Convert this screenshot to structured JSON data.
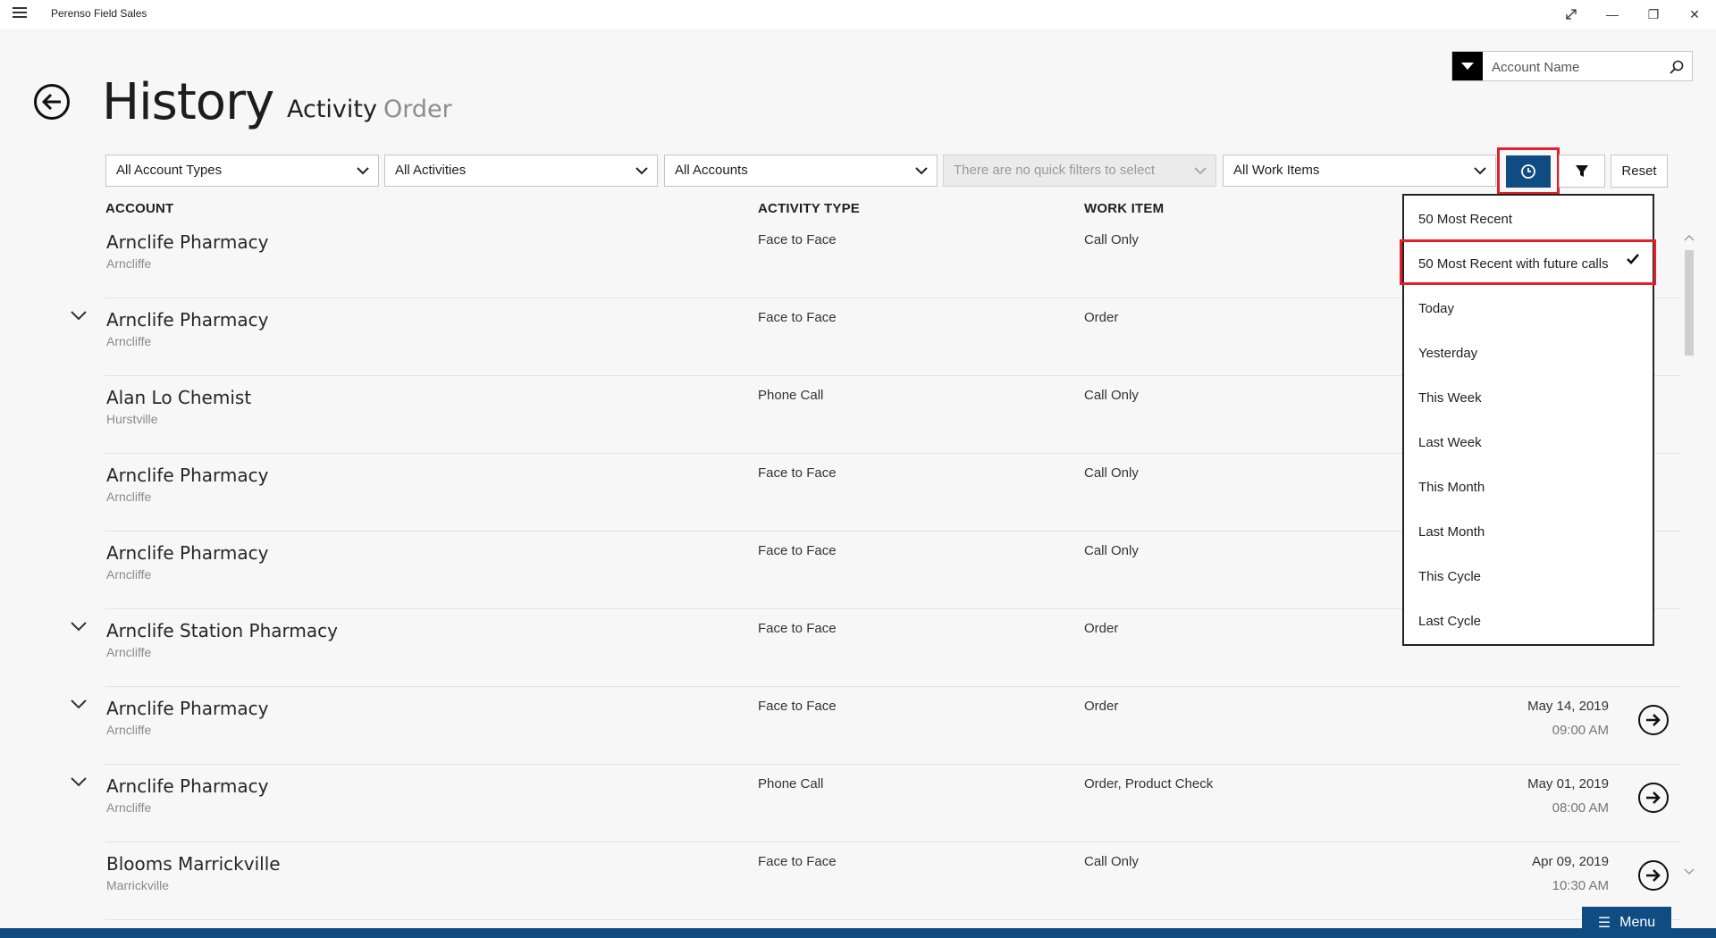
{
  "app": {
    "title": "Perenso Field Sales"
  },
  "window": {
    "restore_icon": "expand-icon",
    "minimize": "—",
    "maximize": "❐",
    "close": "✕"
  },
  "header": {
    "title": "History",
    "tabs": [
      {
        "label": "Activity",
        "active": true
      },
      {
        "label": "Order",
        "active": false
      }
    ]
  },
  "search": {
    "placeholder": "Account Name"
  },
  "filters": {
    "account_types": "All Account Types",
    "activities": "All Activities",
    "accounts": "All Accounts",
    "quick_filters": "There are no quick filters to select",
    "work_items": "All Work Items",
    "reset_label": "Reset"
  },
  "columns": {
    "account": "ACCOUNT",
    "activity_type": "ACTIVITY TYPE",
    "work_item": "WORK ITEM"
  },
  "rows": [
    {
      "name": "Arnclife Pharmacy",
      "suburb": "Arncliffe",
      "activity": "Face to Face",
      "work": "Call Only",
      "date": "",
      "time": "",
      "expandable": false
    },
    {
      "name": "Arnclife Pharmacy",
      "suburb": "Arncliffe",
      "activity": "Face to Face",
      "work": "Order",
      "date": "",
      "time": "",
      "expandable": true
    },
    {
      "name": "Alan Lo Chemist",
      "suburb": "Hurstville",
      "activity": "Phone Call",
      "work": "Call Only",
      "date": "",
      "time": "",
      "expandable": false
    },
    {
      "name": "Arnclife Pharmacy",
      "suburb": "Arncliffe",
      "activity": "Face to Face",
      "work": "Call Only",
      "date": "",
      "time": "",
      "expandable": false
    },
    {
      "name": "Arnclife Pharmacy",
      "suburb": "Arncliffe",
      "activity": "Face to Face",
      "work": "Call Only",
      "date": "",
      "time": "",
      "expandable": false
    },
    {
      "name": "Arnclife Station Pharmacy",
      "suburb": "Arncliffe",
      "activity": "Face to Face",
      "work": "Order",
      "date": "",
      "time": "",
      "expandable": true
    },
    {
      "name": "Arnclife Pharmacy",
      "suburb": "Arncliffe",
      "activity": "Face to Face",
      "work": "Order",
      "date": "May 14, 2019",
      "time": "09:00 AM",
      "expandable": true
    },
    {
      "name": "Arnclife Pharmacy",
      "suburb": "Arncliffe",
      "activity": "Phone Call",
      "work": "Order, Product Check",
      "date": "May 01, 2019",
      "time": "08:00 AM",
      "expandable": true
    },
    {
      "name": "Blooms Marrickville",
      "suburb": "Marrickville",
      "activity": "Face to Face",
      "work": "Call Only",
      "date": "Apr 09, 2019",
      "time": "10:30 AM",
      "expandable": false
    }
  ],
  "period_menu": {
    "items": [
      "50 Most Recent",
      "50 Most Recent with future calls",
      "Today",
      "Yesterday",
      "This Week",
      "Last Week",
      "This Month",
      "Last Month",
      "This Cycle",
      "Last Cycle"
    ],
    "selected": "50 Most Recent with future calls"
  },
  "bottom": {
    "menu_label": "Menu"
  }
}
